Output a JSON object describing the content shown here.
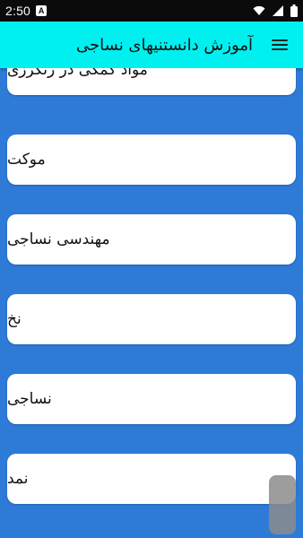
{
  "status_bar": {
    "time": "2:50",
    "notification_badge": "A"
  },
  "app_bar": {
    "title": "آموزش دانستنیهای نساجی",
    "menu_icon": "hamburger-menu-icon"
  },
  "list": {
    "items": [
      {
        "label": "مواد کمکی در رنگرزی"
      },
      {
        "label": "موکت"
      },
      {
        "label": "مهندسی نساجی"
      },
      {
        "label": "نخ"
      },
      {
        "label": "نساجی"
      },
      {
        "label": "نمد"
      }
    ]
  },
  "colors": {
    "app_bar_bg": "#00f0f0",
    "page_bg": "#2d7bd6",
    "card_bg": "#ffffff",
    "status_bar_bg": "#0b0b0b"
  }
}
